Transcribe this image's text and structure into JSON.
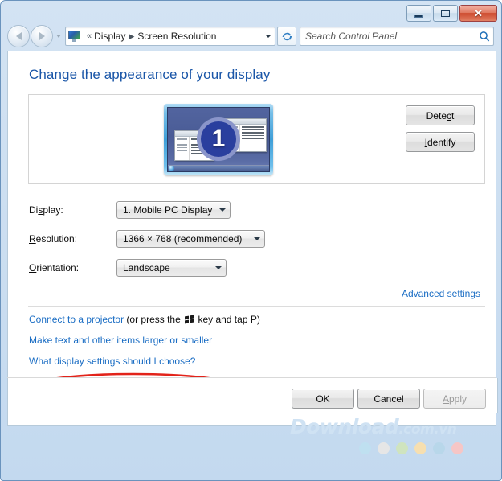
{
  "window": {
    "controls": {
      "minimize": "minimize-button",
      "maximize": "maximize-button",
      "close": "✕"
    }
  },
  "navbar": {
    "back": "back-button",
    "forward": "forward-button",
    "history_dropdown": "recent-pages-dropdown",
    "breadcrumb": {
      "overflow": "«",
      "items": [
        "Display",
        "Screen Resolution"
      ],
      "separator": "▶"
    },
    "refresh": "↯",
    "search": {
      "placeholder": "Search Control Panel",
      "value": ""
    }
  },
  "content": {
    "heading": "Change the appearance of your display",
    "preview": {
      "monitor_number": "1"
    },
    "side_buttons": [
      {
        "id": "detect",
        "pre": "Dete",
        "acc": "c",
        "post": "t"
      },
      {
        "id": "identify",
        "pre": "",
        "acc": "I",
        "post": "dentify"
      }
    ],
    "fields": [
      {
        "id": "display",
        "label_pre": "Di",
        "label_acc": "s",
        "label_post": "play:",
        "value": "1. Mobile PC Display"
      },
      {
        "id": "resolution",
        "label_pre": "",
        "label_acc": "R",
        "label_post": "esolution:",
        "value": "1366 × 768 (recommended)"
      },
      {
        "id": "orientation",
        "label_pre": "",
        "label_acc": "O",
        "label_post": "rientation:",
        "value": "Landscape"
      }
    ],
    "advanced_settings": "Advanced settings",
    "links": {
      "projector_pre": "Connect to a projector",
      "projector_mid": " (or press the ",
      "projector_post": " key and tap P)",
      "make_text": "Make text and other items larger or smaller",
      "what_display": "What display settings should I choose?"
    }
  },
  "footer": {
    "ok": "OK",
    "cancel": "Cancel",
    "apply_pre": "",
    "apply_acc": "A",
    "apply_post": "pply",
    "apply_enabled": false
  },
  "watermark": {
    "brand": "Download",
    "suffix": ".com.vn",
    "dots": [
      "#bfe0f0",
      "#e6e6e6",
      "#cfe4bf",
      "#f6dfb0",
      "#b8d7ea",
      "#f6c6c6"
    ]
  },
  "annotation": {
    "type": "red-ellipse-highlight",
    "color": "#e2231a",
    "targets": "Make text and other items larger or smaller"
  }
}
